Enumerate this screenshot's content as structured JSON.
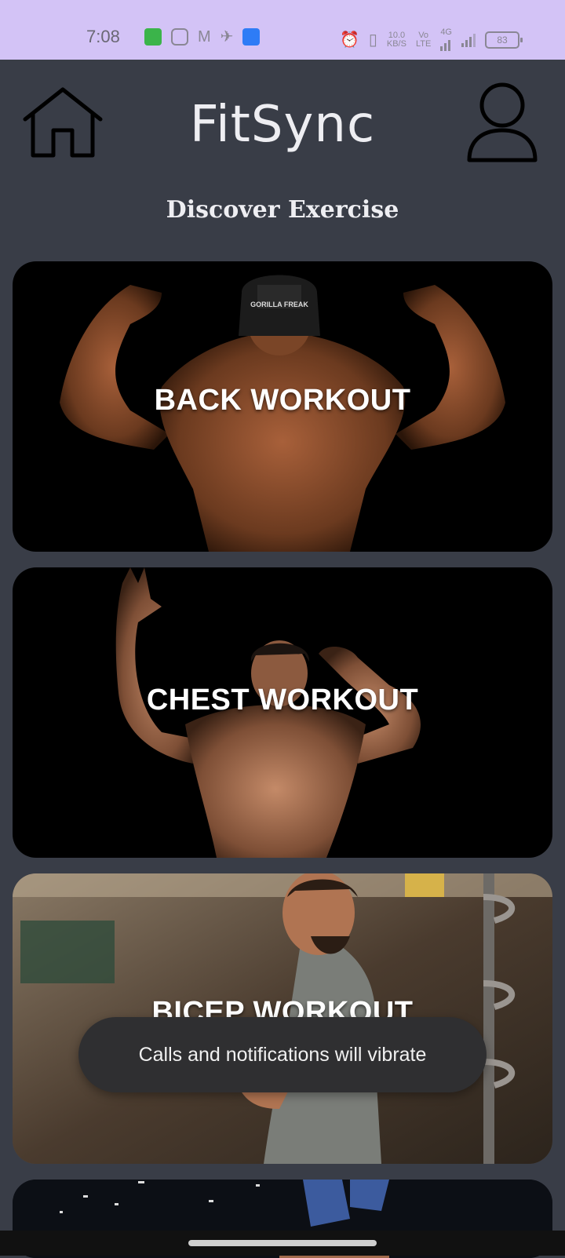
{
  "status_bar": {
    "time": "7:08",
    "network_speed": "10.0",
    "network_unit": "KB/S",
    "volte": "Vo",
    "lte": "LTE",
    "network_type": "4G",
    "battery": "83"
  },
  "header": {
    "title": "FitSync",
    "home_icon": "home-icon",
    "profile_icon": "profile-icon"
  },
  "section_title": "Discover Exercise",
  "workouts": [
    {
      "label": "BACK WORKOUT"
    },
    {
      "label": "CHEST WORKOUT"
    },
    {
      "label": "BICEP WORKOUT"
    }
  ],
  "toast": "Calls and notifications will vibrate",
  "colors": {
    "background": "#393d47",
    "status_bar": "#d3c3f6",
    "card": "#000000",
    "toast": "#2f2f31"
  }
}
